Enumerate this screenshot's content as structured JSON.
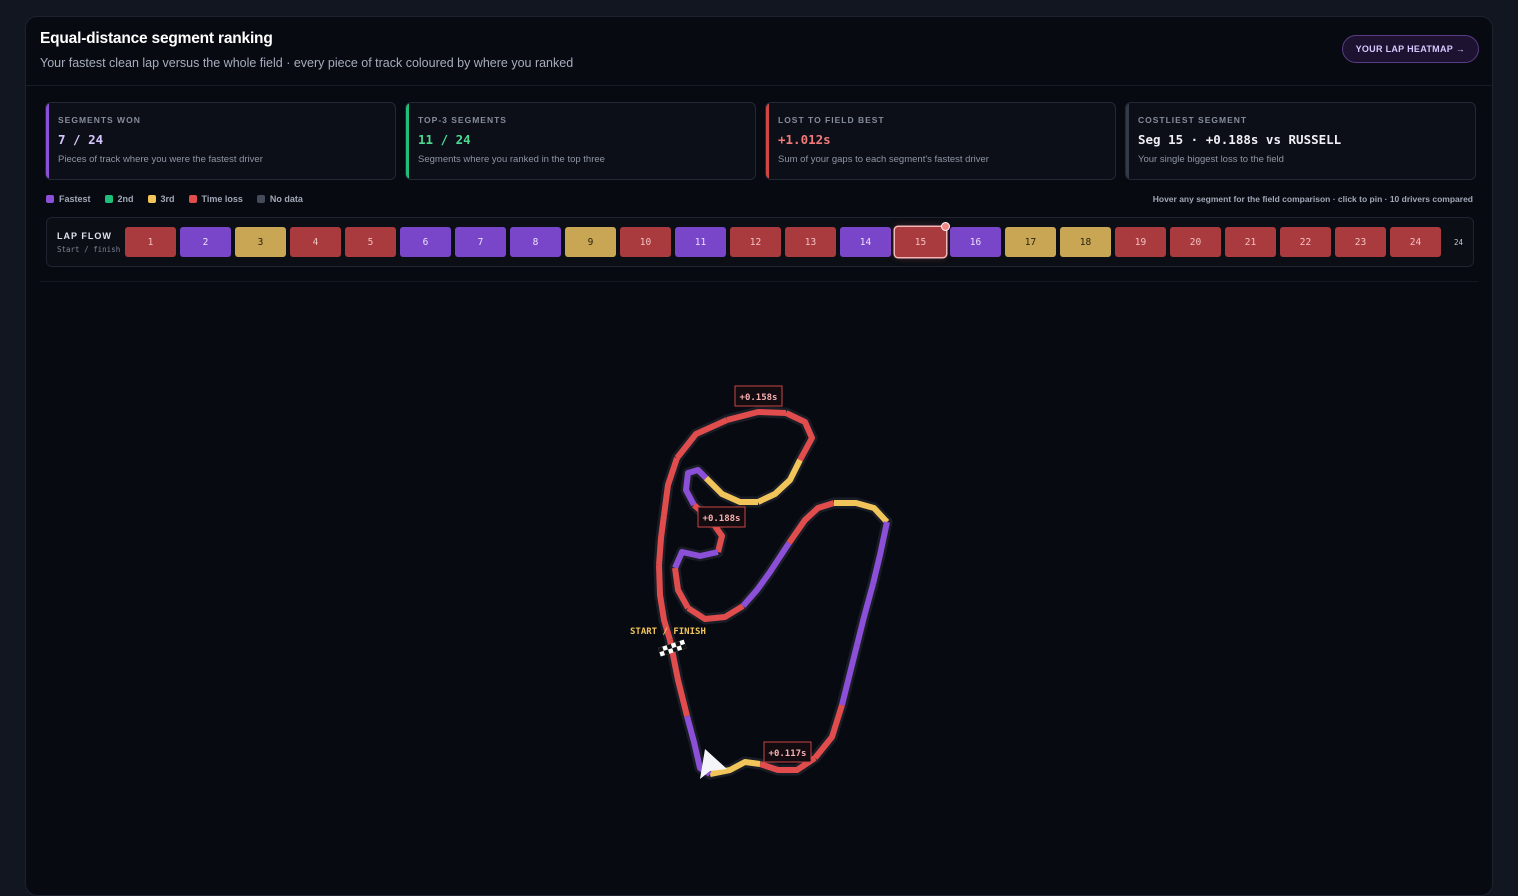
{
  "header": {
    "title": "Equal-distance segment ranking",
    "subtitle": "Your fastest clean lap versus the whole field · every piece of track coloured by where you ranked",
    "heatmap_button": "YOUR LAP HEATMAP →"
  },
  "cards": [
    {
      "label": "SEGMENTS WON",
      "value": "7 / 24",
      "desc": "Pieces of track where you were the fastest driver",
      "accent": "#8b4fd8",
      "value_color": "#d8c7ff"
    },
    {
      "label": "TOP-3 SEGMENTS",
      "value": "11 / 24",
      "desc": "Segments where you ranked in the top three",
      "accent": "#1fbf7b",
      "value_color": "#4bd992"
    },
    {
      "label": "LOST TO FIELD BEST",
      "value": "+1.012s",
      "desc": "Sum of your gaps to each segment's fastest driver",
      "accent": "#d24545",
      "value_color": "#f07a7a"
    },
    {
      "label": "COSTLIEST SEGMENT",
      "value": "Seg 15 · +0.188s vs RUSSELL",
      "desc": "Your single biggest loss to the field",
      "accent": "#343a48",
      "value_color": "#eef0f5"
    }
  ],
  "legend": [
    {
      "label": "Fastest",
      "color": "#8b4fd8"
    },
    {
      "label": "2nd",
      "color": "#1fbf7b"
    },
    {
      "label": "3rd",
      "color": "#f1c55a"
    },
    {
      "label": "Time loss",
      "color": "#e14d4d"
    },
    {
      "label": "No data",
      "color": "#454b5a"
    }
  ],
  "hint": "Hover any segment for the field comparison · click to pin · 10 drivers compared",
  "lap_flow": {
    "title": "LAP FLOW",
    "subtitle": "Start / finish",
    "end_label": "24",
    "selected": 15,
    "segments": [
      {
        "n": "1",
        "rank": "loss"
      },
      {
        "n": "2",
        "rank": "fastest"
      },
      {
        "n": "3",
        "rank": "third"
      },
      {
        "n": "4",
        "rank": "loss"
      },
      {
        "n": "5",
        "rank": "loss"
      },
      {
        "n": "6",
        "rank": "fastest"
      },
      {
        "n": "7",
        "rank": "fastest"
      },
      {
        "n": "8",
        "rank": "fastest"
      },
      {
        "n": "9",
        "rank": "third"
      },
      {
        "n": "10",
        "rank": "loss"
      },
      {
        "n": "11",
        "rank": "fastest"
      },
      {
        "n": "12",
        "rank": "loss"
      },
      {
        "n": "13",
        "rank": "loss"
      },
      {
        "n": "14",
        "rank": "fastest"
      },
      {
        "n": "15",
        "rank": "loss"
      },
      {
        "n": "16",
        "rank": "fastest"
      },
      {
        "n": "17",
        "rank": "third"
      },
      {
        "n": "18",
        "rank": "third"
      },
      {
        "n": "19",
        "rank": "loss"
      },
      {
        "n": "20",
        "rank": "loss"
      },
      {
        "n": "21",
        "rank": "loss"
      },
      {
        "n": "22",
        "rank": "loss"
      },
      {
        "n": "23",
        "rank": "loss"
      },
      {
        "n": "24",
        "rank": "loss"
      }
    ]
  },
  "map": {
    "start_finish_label": "START / FINISH",
    "callouts": [
      "+0.158s",
      "+0.188s",
      "+0.117s"
    ]
  },
  "colors": {
    "fastest": "#8b4fd8",
    "third": "#f1c55a",
    "loss": "#e14d4d",
    "chip_fastest_bg": "#7a46c9",
    "chip_third_bg": "#c9a653",
    "chip_loss_bg": "#a93a3d"
  }
}
